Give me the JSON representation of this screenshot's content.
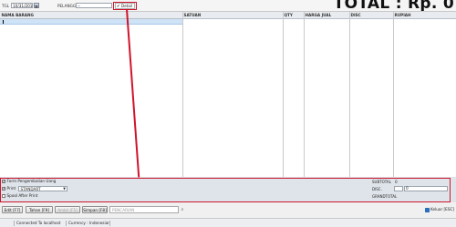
{
  "header": {
    "tgl_label": "TGL",
    "tgl_value": "10/31/201",
    "pelanggan_label": "PELANGGAN",
    "pelanggan_value": "--",
    "detail_label": "Detail",
    "detail_checked": true,
    "total_text": "TOTAL : Rp. 0"
  },
  "grid": {
    "columns": [
      "NAMA BARANG",
      "SATUAN",
      "QTY",
      "HARGA JUAL",
      "DISC",
      "RUPIAH"
    ]
  },
  "options": {
    "form_pengembalian_label": "Form Pengembalian Uang",
    "form_pengembalian_checked": true,
    "print_label": "Print",
    "print_checked": true,
    "print_mode": "STANDART",
    "spool_label": "Spool After Print",
    "spool_checked": false
  },
  "summary": {
    "subtotal_label": "SUBTOTAL",
    "subtotal_value": "0",
    "disc_label": "DISC.",
    "disc_value": "0",
    "grandtotal_label": "GRANDTOTAL"
  },
  "buttons": {
    "edit": "Edit [F7]",
    "tahan": "Tahan [F9]",
    "ambil": "Ambil [F5]",
    "simpan": "Simpan [F8]",
    "search_placeholder": "PENCARIAN",
    "keluar": "Keluar [ESC]"
  },
  "status": {
    "connection": "Connected To localhost",
    "currency": "Currency : Indonesian"
  },
  "colors": {
    "highlight_frame": "#d0142c",
    "selected_row": "#cfe3f7"
  }
}
